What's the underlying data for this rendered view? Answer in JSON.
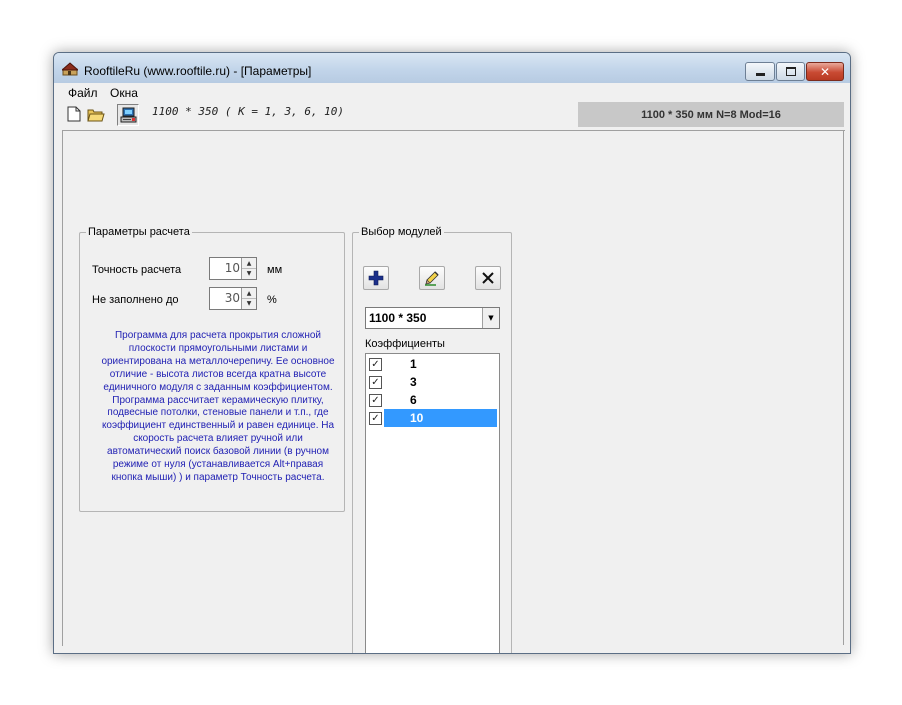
{
  "window": {
    "title": "RooftileRu (www.rooftile.ru) - [Параметры]"
  },
  "menu": [
    "Файл",
    "Окна"
  ],
  "toolbar": {
    "info": "1100 * 350  ( K = 1, 3, 6, 10)",
    "status": "1100 * 350 мм N=8 Mod=16"
  },
  "params": {
    "legend": "Параметры расчета",
    "precision_label": "Точность расчета",
    "precision_value": "10",
    "precision_unit": "мм",
    "fill_label": "Не заполнено до",
    "fill_value": "30",
    "fill_unit": "%",
    "description": "Программа для расчета прокрытия сложной плоскости прямоугольными листами и ориентирована на металлочерепичу. Ее основное отличие - высота листов всегда кратна высоте единичного модуля с заданным коэффициентом. Программа рассчитает керамическую плитку, подвесные  потолки, стеновые панели и т.п., где коэффициент единственный и равен единице. На скорость расчета влияет ручной или автоматический поиск базовой линии (в ручном режиме от нуля (устанавливается Alt+правая кнопка мыши) ) и параметр Точность расчета."
  },
  "modules": {
    "legend": "Выбор модулей",
    "selected": "1100 * 350",
    "coef_label": "Коэффициенты",
    "coefficients": [
      {
        "value": "1",
        "checked": true
      },
      {
        "value": "3",
        "checked": true
      },
      {
        "value": "6",
        "checked": true
      },
      {
        "value": "10",
        "checked": true,
        "selected": true
      }
    ]
  },
  "colors": {
    "description_text": "#1f1fb3",
    "selection": "#3399ff",
    "status_panel": "#c8c8c8"
  }
}
